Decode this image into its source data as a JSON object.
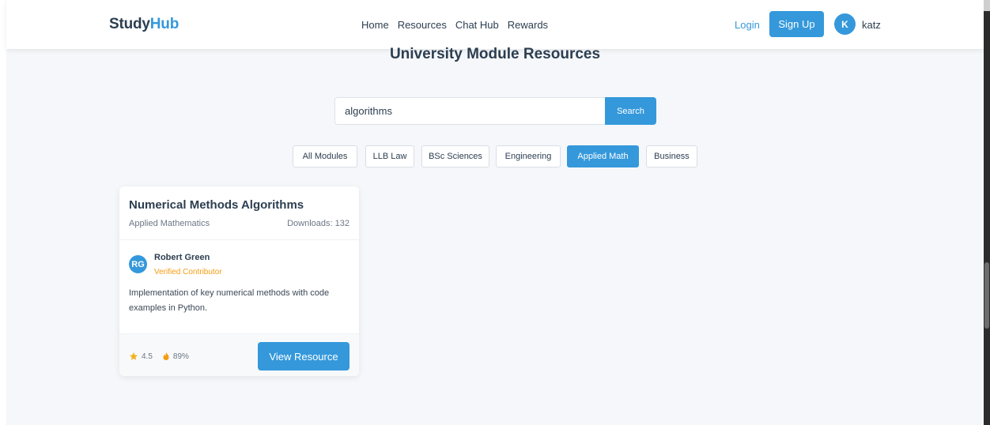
{
  "header": {
    "logo_part1": "Study",
    "logo_part2": "Hub",
    "nav": [
      "Home",
      "Resources",
      "Chat Hub",
      "Rewards"
    ],
    "login_label": "Login",
    "signup_label": "Sign Up",
    "user_initial": "K",
    "username": "katz"
  },
  "page": {
    "title": "University Module Resources"
  },
  "search": {
    "value": "algorithms",
    "button_label": "Search"
  },
  "filters": [
    {
      "label": "All Modules",
      "active": false
    },
    {
      "label": "LLB Law",
      "active": false
    },
    {
      "label": "BSc Sciences",
      "active": false
    },
    {
      "label": "Engineering",
      "active": false
    },
    {
      "label": "Applied Math",
      "active": true
    },
    {
      "label": "Business",
      "active": false
    }
  ],
  "resources": [
    {
      "title": "Numerical Methods Algorithms",
      "category": "Applied Mathematics",
      "downloads": "Downloads: 132",
      "author_initials": "RG",
      "author_name": "Robert Green",
      "author_badge": "Verified Contributor",
      "description": "Implementation of key numerical methods with code examples in Python.",
      "rating": "4.5",
      "approval": "89%",
      "action_label": "View Resource"
    }
  ],
  "colors": {
    "accent": "#3498db",
    "text": "#2c3e50",
    "badge": "#f39c12",
    "background": "#f5f7fa"
  }
}
